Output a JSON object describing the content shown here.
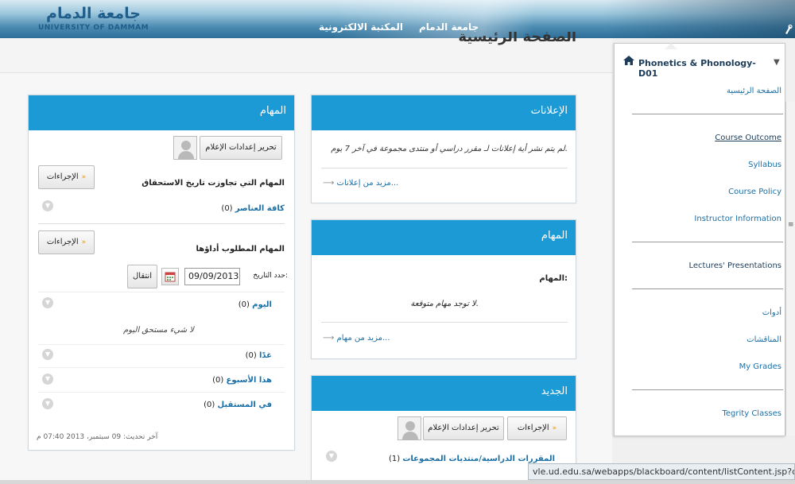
{
  "header": {
    "logo_ar": "جامعة الدمام",
    "logo_en": "UNIVERSITY OF DAMMAM",
    "links": [
      "جامعة الدمام",
      "المكتبة الالكترونية"
    ]
  },
  "page_title": "الصفحة الرئيسية",
  "tasks_module": {
    "title": "المهام",
    "edit_notifications": "تحرير إعدادات الإعلام",
    "actions": "الإجراءات",
    "overdue_heading": "المهام التي تجاوزت تاريخ الاستحقاق",
    "all_items": "كافة العناصر",
    "all_items_count": "(0)",
    "due_heading": "المهام المطلوب أداؤها",
    "select_date_label": "حدد التاريخ:",
    "date_value": "09/09/2013",
    "go_button": "انتقال",
    "today": "اليوم",
    "today_count": "(0)",
    "nothing_today": "لا شيء مستحق اليوم",
    "tomorrow": "غدًا",
    "tomorrow_count": "(0)",
    "this_week": "هذا الأسبوع",
    "this_week_count": "(0)",
    "future": "في المستقبل",
    "future_count": "(0)",
    "last_updated": "آخر تحديث: 09 سبتمبر، 2013 07:40 م"
  },
  "announcements_module": {
    "title": "الإعلانات",
    "message": "لم يتم نشر أية إعلانات لـ مقرر دراسي أو منتدى مجموعة في آخر 7 يوم.",
    "more": "مزيد من إعلانات..."
  },
  "duties_module": {
    "title": "المهام",
    "label": "المهام:",
    "none": "لا توجد مهام متوقعة.",
    "more": "مزيد من مهام..."
  },
  "new_module": {
    "title": "الجديد",
    "actions": "الإجراءات",
    "edit_notifications": "تحرير إعدادات الإعلام",
    "courses_groups": "المقررات الدراسية/منتديات المجموعات",
    "courses_groups_count": "(1)"
  },
  "course_menu": {
    "course_title": "Phonetics & Phonology-D01",
    "items": {
      "home": "الصفحة الرئيسية",
      "course_outcome": "Course Outcome",
      "syllabus": "Syllabus",
      "course_policy": "Course Policy",
      "instructor_info": "Instructor Information",
      "lectures": "Lectures' Presentations",
      "tools": "أدوات",
      "discussions": "المناقشات",
      "my_grades": "My Grades",
      "tegrity": "Tegrity Classes"
    }
  },
  "status_url": "vle.ud.edu.sa/webapps/blackboard/content/listContent.jsp?c...",
  "colors": {
    "module_header": "#1b9ad6",
    "link": "#1a6fa5",
    "highlight": "#ffff2a"
  }
}
